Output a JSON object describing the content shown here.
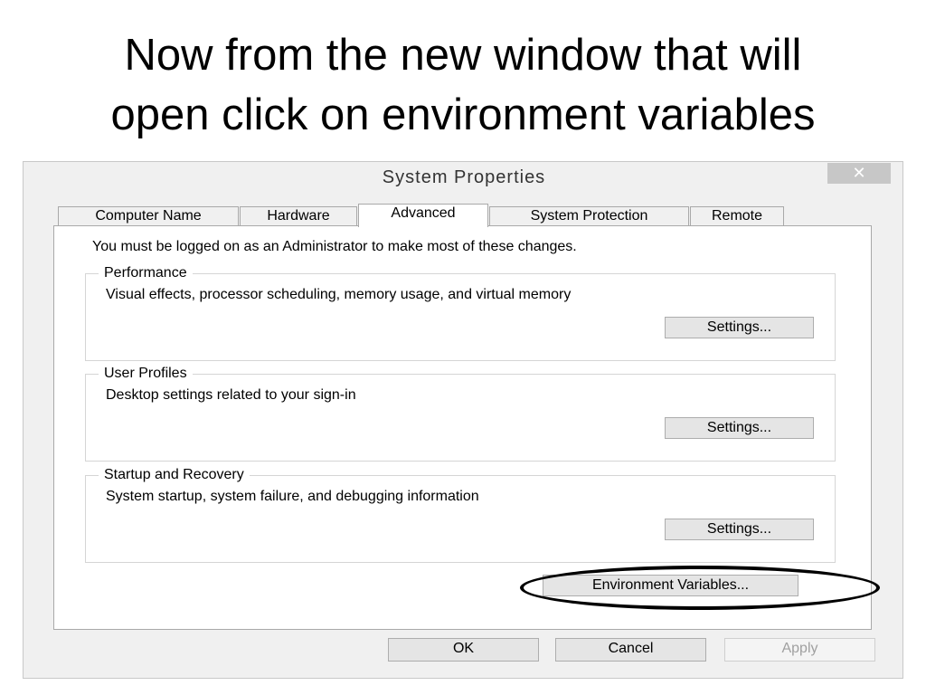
{
  "slide": {
    "title_line1": "Now from the new window that will",
    "title_line2": "open click on environment variables"
  },
  "dialog": {
    "title": "System Properties",
    "close_glyph": "✕",
    "tabs": [
      {
        "label": "Computer Name",
        "active": false
      },
      {
        "label": "Hardware",
        "active": false
      },
      {
        "label": "Advanced",
        "active": true
      },
      {
        "label": "System Protection",
        "active": false
      },
      {
        "label": "Remote",
        "active": false
      }
    ],
    "note": "You must be logged on as an Administrator to make most of these changes.",
    "groups": [
      {
        "legend": "Performance",
        "description": "Visual effects, processor scheduling, memory usage, and virtual memory",
        "button": "Settings..."
      },
      {
        "legend": "User Profiles",
        "description": "Desktop settings related to your sign-in",
        "button": "Settings..."
      },
      {
        "legend": "Startup and Recovery",
        "description": "System startup, system failure, and debugging information",
        "button": "Settings..."
      }
    ],
    "env_button": "Environment Variables...",
    "footer": {
      "ok": "OK",
      "cancel": "Cancel",
      "apply": "Apply"
    }
  },
  "annotation": {
    "color": "#000000",
    "shape": "oval"
  }
}
